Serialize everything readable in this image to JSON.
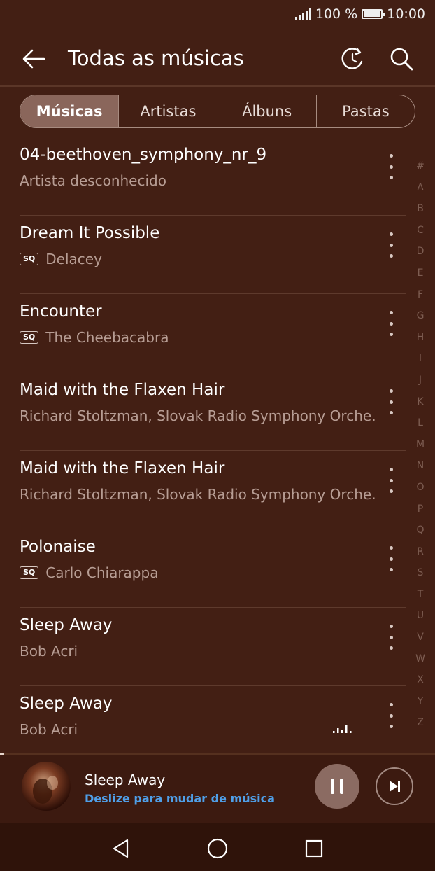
{
  "status": {
    "battery": "100 %",
    "time": "10:00"
  },
  "header": {
    "title": "Todas as músicas"
  },
  "tabs": [
    {
      "label": "Músicas",
      "active": true
    },
    {
      "label": "Artistas",
      "active": false
    },
    {
      "label": "Álbuns",
      "active": false
    },
    {
      "label": "Pastas",
      "active": false
    }
  ],
  "songs": [
    {
      "title": "04-beethoven_symphony_nr_9",
      "artist": "Artista desconhecido",
      "sq": false,
      "playing": false
    },
    {
      "title": "Dream It Possible",
      "artist": "Delacey",
      "sq": true,
      "playing": false
    },
    {
      "title": "Encounter",
      "artist": "The Cheebacabra",
      "sq": true,
      "playing": false
    },
    {
      "title": "Maid with the Flaxen Hair",
      "artist": "Richard Stoltzman, Slovak Radio Symphony Orche…",
      "sq": false,
      "playing": false
    },
    {
      "title": "Maid with the Flaxen Hair",
      "artist": "Richard Stoltzman, Slovak Radio Symphony Orche…",
      "sq": false,
      "playing": false
    },
    {
      "title": "Polonaise",
      "artist": "Carlo Chiarappa",
      "sq": true,
      "playing": false
    },
    {
      "title": "Sleep Away",
      "artist": "Bob Acri",
      "sq": false,
      "playing": false
    },
    {
      "title": "Sleep Away",
      "artist": "Bob Acri",
      "sq": false,
      "playing": true
    }
  ],
  "sq_badge": "SQ",
  "alphabet": [
    "#",
    "A",
    "B",
    "C",
    "D",
    "E",
    "F",
    "G",
    "H",
    "I",
    "J",
    "K",
    "L",
    "M",
    "N",
    "O",
    "P",
    "Q",
    "R",
    "S",
    "T",
    "U",
    "V",
    "W",
    "X",
    "Y",
    "Z"
  ],
  "now_playing": {
    "title": "Sleep Away",
    "hint": "Deslize para mudar de música",
    "progress": 0.01
  },
  "colors": {
    "background": "#431f14",
    "accent": "#4f9fe8",
    "tab_active": "#8a665b"
  }
}
